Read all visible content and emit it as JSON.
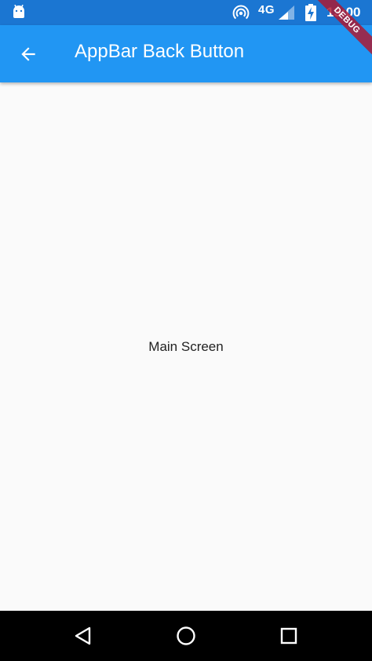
{
  "status_bar": {
    "network": "4G",
    "time": "13:00",
    "icons": [
      "android-icon",
      "hotspot-icon",
      "signal-icon",
      "battery-charging-icon"
    ]
  },
  "app_bar": {
    "title": "AppBar Back Button",
    "back_icon": "arrow-back-icon"
  },
  "body": {
    "text": "Main Screen"
  },
  "debug_banner": {
    "label": "DEBUG"
  },
  "nav_bar": {
    "icons": [
      "nav-back-icon",
      "nav-home-icon",
      "nav-recent-icon"
    ]
  },
  "colors": {
    "status_bar": "#1b76d2",
    "app_bar": "#2196f3",
    "background": "#fafafa",
    "nav_bar": "#000000",
    "debug_ribbon": "#b0162d"
  }
}
